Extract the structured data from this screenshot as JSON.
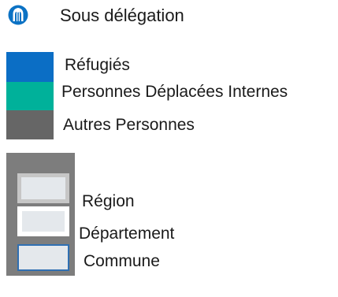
{
  "legend": {
    "office": {
      "label": "Sous délégation",
      "icon": "sub-delegation-office-icon",
      "icon_color": "#0b72c4"
    },
    "population_types": [
      {
        "label": "Réfugiés",
        "color": "#0b6ec5"
      },
      {
        "label": "Personnes Déplacées Internes",
        "color": "#00b19a"
      },
      {
        "label": "Autres Personnes",
        "color": "#666666"
      }
    ],
    "admin_levels": {
      "panel_color": "#7d7d7d",
      "items": [
        {
          "label": "Région",
          "fill": "#e4e8ec",
          "border": "#c6c6c6"
        },
        {
          "label": "Département",
          "fill": "#e4e8ec",
          "border": "#ffffff"
        },
        {
          "label": "Commune",
          "fill": "#e4e8ec",
          "border": "#2f6fb2"
        }
      ]
    }
  }
}
